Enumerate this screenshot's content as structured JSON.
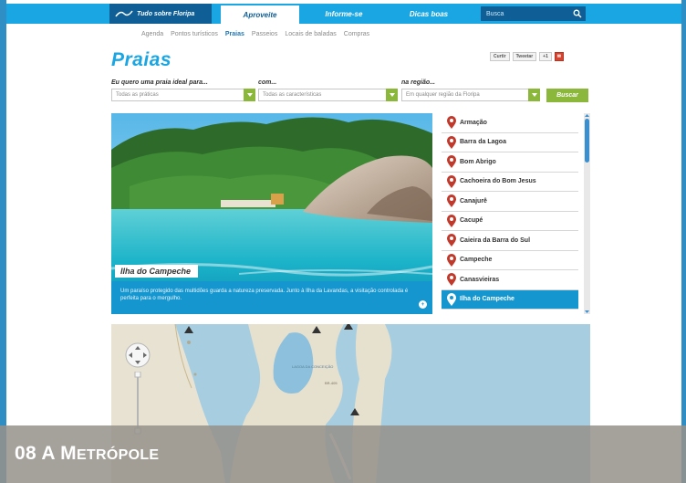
{
  "topnav": {
    "logo_text": "Tudo sobre Floripa",
    "tabs": [
      {
        "label": "Aproveite",
        "active": true
      },
      {
        "label": "Informe-se",
        "active": false
      },
      {
        "label": "Dicas boas",
        "active": false
      }
    ],
    "search_placeholder": "Busca"
  },
  "subnav": {
    "items": [
      {
        "label": "Agenda",
        "active": false
      },
      {
        "label": "Pontos turísticos",
        "active": false
      },
      {
        "label": "Praias",
        "active": true
      },
      {
        "label": "Passeios",
        "active": false
      },
      {
        "label": "Locais de baladas",
        "active": false
      },
      {
        "label": "Compras",
        "active": false
      }
    ]
  },
  "page_title": "Praias",
  "share": {
    "facebook": "Curtir",
    "twitter": "Tweetar",
    "plus": "+1"
  },
  "filters": {
    "f1": {
      "label": "Eu quero uma praia ideal para...",
      "value": "Todas as práticas"
    },
    "f2": {
      "label": "com...",
      "value": "Todas as características"
    },
    "f3": {
      "label": "na região...",
      "value": "Em qualquer região da Floripa"
    },
    "search_button": "Buscar"
  },
  "hero": {
    "title": "Ilha do Campeche",
    "caption": "Um paraíso protegido das multidões guarda a natureza preservada. Junto à Ilha da Lavandas, a visitação controlada é perfeita para o mergulho."
  },
  "beaches": [
    {
      "name": "Armação",
      "selected": false
    },
    {
      "name": "Barra da Lagoa",
      "selected": false
    },
    {
      "name": "Bom Abrigo",
      "selected": false
    },
    {
      "name": "Cachoeira do Bom Jesus",
      "selected": false
    },
    {
      "name": "Canajurê",
      "selected": false
    },
    {
      "name": "Cacupé",
      "selected": false
    },
    {
      "name": "Caieira da Barra do Sul",
      "selected": false
    },
    {
      "name": "Campeche",
      "selected": false
    },
    {
      "name": "Canasvieiras",
      "selected": false
    },
    {
      "name": "Ilha do Campeche",
      "selected": true
    }
  ],
  "map": {
    "lake_label": "LAGOA DA CONCEIÇÃO",
    "town_label": "BR-405"
  },
  "chapter": {
    "number": "08",
    "title_first": "A M",
    "title_rest": "ETRÓPOLE"
  },
  "colors": {
    "brand_blue": "#1aa6e2",
    "dark_blue": "#0f5f96",
    "green": "#8bb83a",
    "selected": "#1596cf"
  }
}
